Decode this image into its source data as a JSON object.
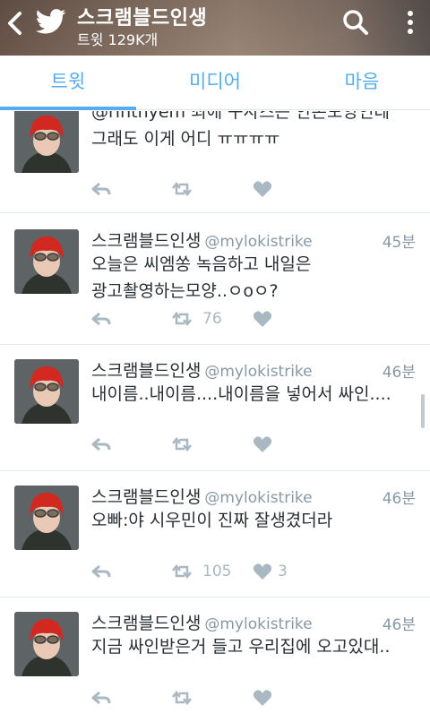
{
  "header": {
    "title": "스크램블드인생",
    "subtitle": "트윗 129K개"
  },
  "tabs": [
    {
      "label": "트윗",
      "active": true
    },
    {
      "label": "미디어",
      "active": false
    },
    {
      "label": "마음",
      "active": false
    }
  ],
  "tweets": [
    {
      "name": "",
      "handle": "",
      "time": "",
      "lines": [
        "@rinthyem 최애 구사즈는 안온모양인데",
        "그래도 이게 어디 ㅠㅠㅠㅠ"
      ],
      "retweets": "",
      "likes": ""
    },
    {
      "name": "스크램블드인생",
      "handle": "@mylokistrike",
      "time": "45분",
      "lines": [
        "오늘은 씨엠쏭 녹음하고 내일은",
        "광고촬영하는모양..ㅇoㅇ?"
      ],
      "retweets": "76",
      "likes": ""
    },
    {
      "name": "스크램블드인생",
      "handle": "@mylokistrike",
      "time": "46분",
      "lines": [
        "내이름..내이름....내이름을 넣어서 싸인...."
      ],
      "retweets": "",
      "likes": ""
    },
    {
      "name": "스크램블드인생",
      "handle": "@mylokistrike",
      "time": "46분",
      "lines": [
        "오빠:야 시우민이 진짜 잘생겼더라"
      ],
      "retweets": "105",
      "likes": "3"
    },
    {
      "name": "스크램블드인생",
      "handle": "@mylokistrike",
      "time": "46분",
      "lines": [
        "지금 싸인받은거 들고 우리집에 오고있대.."
      ],
      "retweets": "",
      "likes": ""
    }
  ],
  "colors": {
    "accent": "#55acee",
    "text": "#292f33",
    "muted": "#8899a6",
    "action": "#aab8c2"
  }
}
